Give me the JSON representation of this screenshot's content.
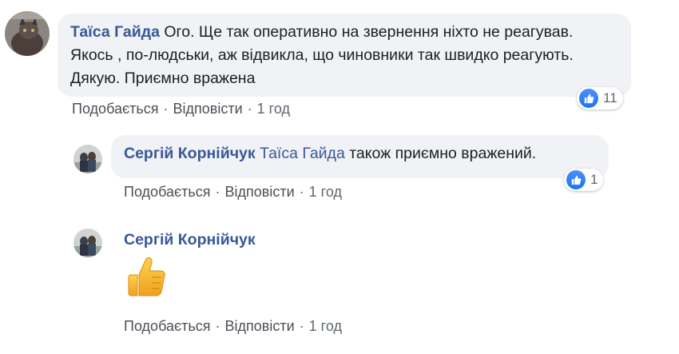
{
  "comments": [
    {
      "author": "Таїса Гайда",
      "text": "Ого. Ще так оперативно на звернення ніхто не реагував. Якось , по-людськи, аж відвикла, що чиновники так швидко реагують. Дякую. Приємно вражена",
      "like_label": "Подобається",
      "reply_label": "Відповісти",
      "time": "1 год",
      "reaction_count": "11"
    },
    {
      "author": "Сергій Корнійчук",
      "mention": "Таїса Гайда",
      "text": "також приємно вражений.",
      "like_label": "Подобається",
      "reply_label": "Відповісти",
      "time": "1 год",
      "reaction_count": "1"
    },
    {
      "author": "Сергій Корнійчук",
      "sticker": "thumbs-up-emoji",
      "like_label": "Подобається",
      "reply_label": "Відповісти",
      "time": "1 год"
    }
  ],
  "separator": "·",
  "colors": {
    "author": "#385898",
    "bubble": "#f0f2f5",
    "meta": "#606770",
    "like_blue": "#1877f2",
    "thumb_yellow": "#f7b928"
  }
}
